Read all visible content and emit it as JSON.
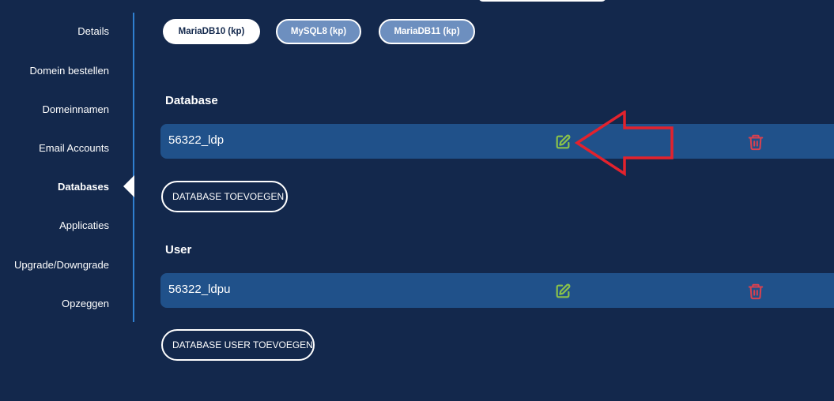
{
  "sidebar": {
    "items": [
      {
        "label": "Details"
      },
      {
        "label": "Domein bestellen"
      },
      {
        "label": "Domeinnamen"
      },
      {
        "label": "Email Accounts"
      },
      {
        "label": "Databases"
      },
      {
        "label": "Applicaties"
      },
      {
        "label": "Upgrade/Downgrade"
      },
      {
        "label": "Opzeggen"
      }
    ],
    "active": "Databases"
  },
  "tabs": [
    {
      "label": "MariaDB10 (kp)",
      "active": true
    },
    {
      "label": "MySQL8 (kp)",
      "active": false
    },
    {
      "label": "MariaDB11 (kp)",
      "active": false
    }
  ],
  "database": {
    "title": "Database",
    "rows": [
      {
        "name": "56322_ldp",
        "edit_icon": "edit-icon",
        "delete_icon": "trash-icon"
      }
    ],
    "add_button": "DATABASE TOEVOEGEN"
  },
  "user": {
    "title": "User",
    "rows": [
      {
        "name": "56322_ldpu",
        "edit_icon": "edit-icon",
        "delete_icon": "trash-icon"
      }
    ],
    "add_button": "DATABASE USER TOEVOEGEN"
  },
  "colors": {
    "background": "#13284c",
    "row": "#20518a",
    "edit": "#8ac24a",
    "delete": "#d9414f",
    "annotation": "#e3222d",
    "sidebar_border": "#2f7fd0"
  }
}
